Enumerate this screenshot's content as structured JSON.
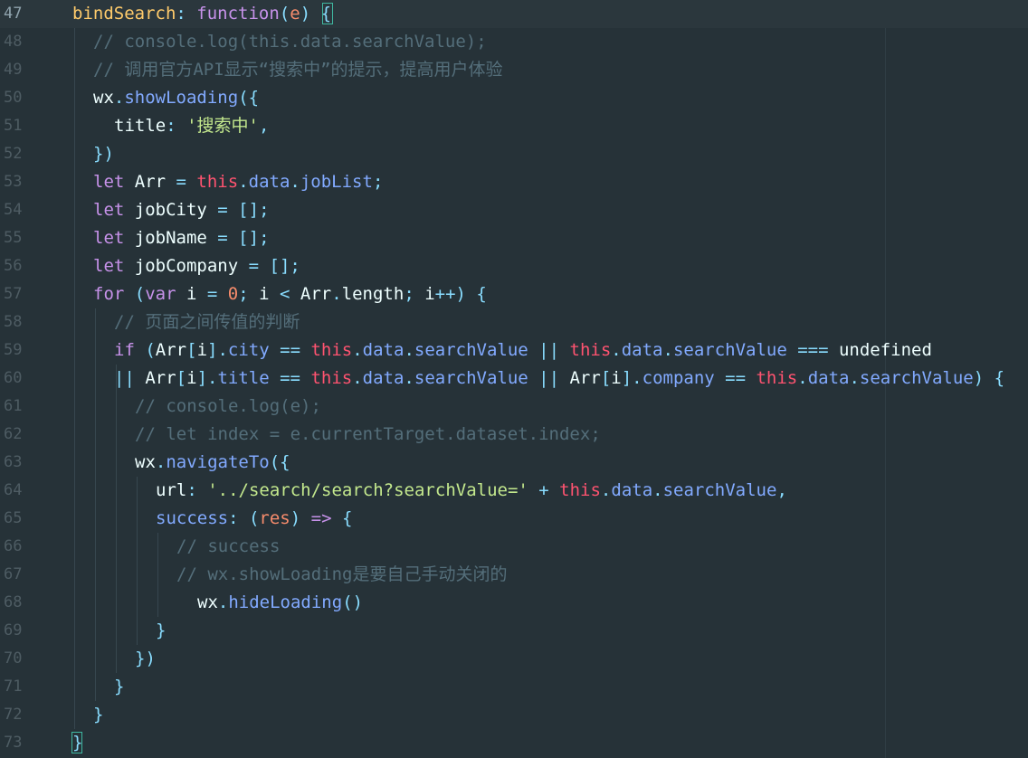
{
  "editor": {
    "active_line": "47",
    "colors": {
      "background": "#263238",
      "text": "#eeffff",
      "keyword": "#c792ea",
      "function": "#82aaff",
      "this": "#ff5370",
      "property": "#82aaff",
      "string": "#c3e88d",
      "number": "#f78c6c",
      "comment": "#546e7a",
      "operator": "#89ddff",
      "punct": "#89ddff",
      "key": "#ffcb6b",
      "param": "#f78c6c",
      "line_number": "#4e5c63"
    },
    "lines": [
      {
        "num": "47",
        "indent": 0,
        "tokens": [
          {
            "t": "bindSearch",
            "c": "key"
          },
          {
            "t": ": ",
            "c": "punct"
          },
          {
            "t": "function",
            "c": "keyword"
          },
          {
            "t": "(",
            "c": "punct"
          },
          {
            "t": "e",
            "c": "param"
          },
          {
            "t": ") ",
            "c": "punct"
          },
          {
            "t": "{",
            "c": "punct"
          }
        ]
      },
      {
        "num": "48",
        "indent": 1,
        "tokens": [
          {
            "t": "// console.log(this.data.searchValue);",
            "c": "comment"
          }
        ]
      },
      {
        "num": "49",
        "indent": 1,
        "tokens": [
          {
            "t": "// 调用官方API显示“搜索中”的提示，提高用户体验",
            "c": "comment"
          }
        ]
      },
      {
        "num": "50",
        "indent": 1,
        "tokens": [
          {
            "t": "wx",
            "c": "text"
          },
          {
            "t": ".",
            "c": "punct"
          },
          {
            "t": "showLoading",
            "c": "function"
          },
          {
            "t": "({",
            "c": "punct"
          }
        ]
      },
      {
        "num": "51",
        "indent": 2,
        "tokens": [
          {
            "t": "title",
            "c": "text"
          },
          {
            "t": ": ",
            "c": "punct"
          },
          {
            "t": "'搜索中'",
            "c": "string"
          },
          {
            "t": ",",
            "c": "punct"
          }
        ]
      },
      {
        "num": "52",
        "indent": 1,
        "tokens": [
          {
            "t": "})",
            "c": "punct"
          }
        ]
      },
      {
        "num": "53",
        "indent": 1,
        "tokens": [
          {
            "t": "let ",
            "c": "keyword"
          },
          {
            "t": "Arr ",
            "c": "text"
          },
          {
            "t": "= ",
            "c": "operator"
          },
          {
            "t": "this",
            "c": "this"
          },
          {
            "t": ".",
            "c": "punct"
          },
          {
            "t": "data",
            "c": "property"
          },
          {
            "t": ".",
            "c": "punct"
          },
          {
            "t": "jobList",
            "c": "property"
          },
          {
            "t": ";",
            "c": "punct"
          }
        ]
      },
      {
        "num": "54",
        "indent": 1,
        "tokens": [
          {
            "t": "let ",
            "c": "keyword"
          },
          {
            "t": "jobCity ",
            "c": "text"
          },
          {
            "t": "= ",
            "c": "operator"
          },
          {
            "t": "[]",
            "c": "punct"
          },
          {
            "t": ";",
            "c": "punct"
          }
        ]
      },
      {
        "num": "55",
        "indent": 1,
        "tokens": [
          {
            "t": "let ",
            "c": "keyword"
          },
          {
            "t": "jobName ",
            "c": "text"
          },
          {
            "t": "= ",
            "c": "operator"
          },
          {
            "t": "[]",
            "c": "punct"
          },
          {
            "t": ";",
            "c": "punct"
          }
        ]
      },
      {
        "num": "56",
        "indent": 1,
        "tokens": [
          {
            "t": "let ",
            "c": "keyword"
          },
          {
            "t": "jobCompany ",
            "c": "text"
          },
          {
            "t": "= ",
            "c": "operator"
          },
          {
            "t": "[]",
            "c": "punct"
          },
          {
            "t": ";",
            "c": "punct"
          }
        ]
      },
      {
        "num": "57",
        "indent": 1,
        "tokens": [
          {
            "t": "for ",
            "c": "keyword"
          },
          {
            "t": "(",
            "c": "punct"
          },
          {
            "t": "var ",
            "c": "keyword"
          },
          {
            "t": "i ",
            "c": "text"
          },
          {
            "t": "= ",
            "c": "operator"
          },
          {
            "t": "0",
            "c": "number"
          },
          {
            "t": "; ",
            "c": "punct"
          },
          {
            "t": "i ",
            "c": "text"
          },
          {
            "t": "< ",
            "c": "operator"
          },
          {
            "t": "Arr",
            "c": "text"
          },
          {
            "t": ".",
            "c": "punct"
          },
          {
            "t": "length",
            "c": "text"
          },
          {
            "t": "; ",
            "c": "punct"
          },
          {
            "t": "i",
            "c": "text"
          },
          {
            "t": "++",
            "c": "operator"
          },
          {
            "t": ") {",
            "c": "punct"
          }
        ]
      },
      {
        "num": "58",
        "indent": 2,
        "tokens": [
          {
            "t": "// 页面之间传值的判断",
            "c": "comment"
          }
        ]
      },
      {
        "num": "59",
        "indent": 2,
        "tokens": [
          {
            "t": "if ",
            "c": "keyword"
          },
          {
            "t": "(",
            "c": "punct"
          },
          {
            "t": "Arr",
            "c": "text"
          },
          {
            "t": "[",
            "c": "punct"
          },
          {
            "t": "i",
            "c": "text"
          },
          {
            "t": "]",
            "c": "punct"
          },
          {
            "t": ".",
            "c": "punct"
          },
          {
            "t": "city ",
            "c": "property"
          },
          {
            "t": "== ",
            "c": "operator"
          },
          {
            "t": "this",
            "c": "this"
          },
          {
            "t": ".",
            "c": "punct"
          },
          {
            "t": "data",
            "c": "property"
          },
          {
            "t": ".",
            "c": "punct"
          },
          {
            "t": "searchValue ",
            "c": "property"
          },
          {
            "t": "|| ",
            "c": "operator"
          },
          {
            "t": "this",
            "c": "this"
          },
          {
            "t": ".",
            "c": "punct"
          },
          {
            "t": "data",
            "c": "property"
          },
          {
            "t": ".",
            "c": "punct"
          },
          {
            "t": "searchValue ",
            "c": "property"
          },
          {
            "t": "=== ",
            "c": "operator"
          },
          {
            "t": "undefined",
            "c": "text"
          }
        ]
      },
      {
        "num": "60",
        "indent": 2,
        "tokens": [
          {
            "t": "|| ",
            "c": "operator"
          },
          {
            "t": "Arr",
            "c": "text"
          },
          {
            "t": "[",
            "c": "punct"
          },
          {
            "t": "i",
            "c": "text"
          },
          {
            "t": "]",
            "c": "punct"
          },
          {
            "t": ".",
            "c": "punct"
          },
          {
            "t": "title ",
            "c": "property"
          },
          {
            "t": "== ",
            "c": "operator"
          },
          {
            "t": "this",
            "c": "this"
          },
          {
            "t": ".",
            "c": "punct"
          },
          {
            "t": "data",
            "c": "property"
          },
          {
            "t": ".",
            "c": "punct"
          },
          {
            "t": "searchValue ",
            "c": "property"
          },
          {
            "t": "|| ",
            "c": "operator"
          },
          {
            "t": "Arr",
            "c": "text"
          },
          {
            "t": "[",
            "c": "punct"
          },
          {
            "t": "i",
            "c": "text"
          },
          {
            "t": "]",
            "c": "punct"
          },
          {
            "t": ".",
            "c": "punct"
          },
          {
            "t": "company ",
            "c": "property"
          },
          {
            "t": "== ",
            "c": "operator"
          },
          {
            "t": "this",
            "c": "this"
          },
          {
            "t": ".",
            "c": "punct"
          },
          {
            "t": "data",
            "c": "property"
          },
          {
            "t": ".",
            "c": "punct"
          },
          {
            "t": "searchValue",
            "c": "property"
          },
          {
            "t": ") {",
            "c": "punct"
          }
        ]
      },
      {
        "num": "61",
        "indent": 3,
        "tokens": [
          {
            "t": "// console.log(e);",
            "c": "comment"
          }
        ]
      },
      {
        "num": "62",
        "indent": 3,
        "tokens": [
          {
            "t": "// let index = e.currentTarget.dataset.index;",
            "c": "comment"
          }
        ]
      },
      {
        "num": "63",
        "indent": 3,
        "tokens": [
          {
            "t": "wx",
            "c": "text"
          },
          {
            "t": ".",
            "c": "punct"
          },
          {
            "t": "navigateTo",
            "c": "function"
          },
          {
            "t": "({",
            "c": "punct"
          }
        ]
      },
      {
        "num": "64",
        "indent": 4,
        "tokens": [
          {
            "t": "url",
            "c": "text"
          },
          {
            "t": ": ",
            "c": "punct"
          },
          {
            "t": "'../search/search?searchValue='",
            "c": "string"
          },
          {
            "t": " + ",
            "c": "operator"
          },
          {
            "t": "this",
            "c": "this"
          },
          {
            "t": ".",
            "c": "punct"
          },
          {
            "t": "data",
            "c": "property"
          },
          {
            "t": ".",
            "c": "punct"
          },
          {
            "t": "searchValue",
            "c": "property"
          },
          {
            "t": ",",
            "c": "punct"
          }
        ]
      },
      {
        "num": "65",
        "indent": 4,
        "tokens": [
          {
            "t": "success",
            "c": "function"
          },
          {
            "t": ": ",
            "c": "punct"
          },
          {
            "t": "(",
            "c": "punct"
          },
          {
            "t": "res",
            "c": "param"
          },
          {
            "t": ") ",
            "c": "punct"
          },
          {
            "t": "=> ",
            "c": "keyword"
          },
          {
            "t": "{",
            "c": "punct"
          }
        ]
      },
      {
        "num": "66",
        "indent": 5,
        "tokens": [
          {
            "t": "// success",
            "c": "comment"
          }
        ]
      },
      {
        "num": "67",
        "indent": 5,
        "tokens": [
          {
            "t": "// wx.showLoading是要自己手动关闭的",
            "c": "comment"
          }
        ]
      },
      {
        "num": "68",
        "indent": 6,
        "tokens": [
          {
            "t": "wx",
            "c": "text"
          },
          {
            "t": ".",
            "c": "punct"
          },
          {
            "t": "hideLoading",
            "c": "function"
          },
          {
            "t": "()",
            "c": "punct"
          }
        ]
      },
      {
        "num": "69",
        "indent": 4,
        "tokens": [
          {
            "t": "}",
            "c": "punct"
          }
        ]
      },
      {
        "num": "70",
        "indent": 3,
        "tokens": [
          {
            "t": "})",
            "c": "punct"
          }
        ]
      },
      {
        "num": "71",
        "indent": 2,
        "tokens": [
          {
            "t": "}",
            "c": "punct"
          }
        ]
      },
      {
        "num": "72",
        "indent": 1,
        "tokens": [
          {
            "t": "}",
            "c": "punct"
          }
        ]
      },
      {
        "num": "73",
        "indent": 0,
        "tokens": [
          {
            "t": "}",
            "c": "punct"
          }
        ]
      }
    ]
  }
}
